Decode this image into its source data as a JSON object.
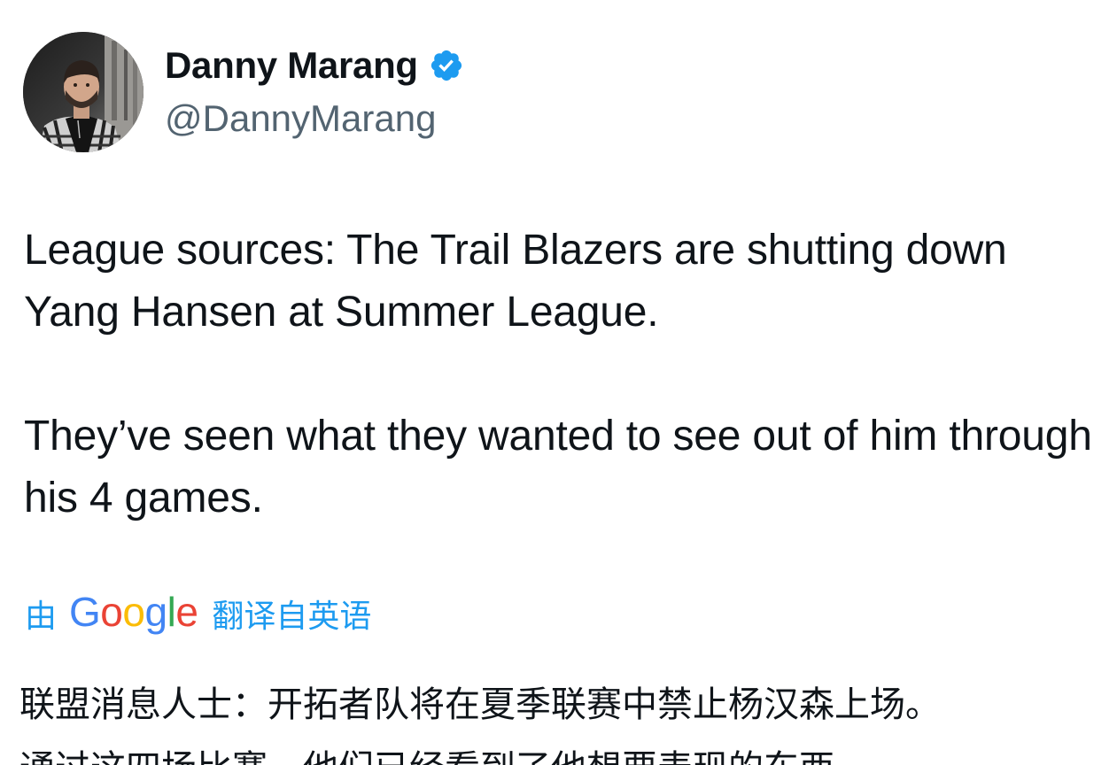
{
  "author": {
    "display_name": "Danny Marang",
    "handle": "@DannyMarang",
    "verified": true,
    "verified_color": "#1d9bf0"
  },
  "tweet": {
    "paragraphs": [
      "League sources: The Trail Blazers are shutting down Yang Hansen at Summer League.",
      "They’ve seen what they wanted to see out of him through his 4 games."
    ]
  },
  "translation": {
    "prefix": "由",
    "provider_letters": [
      "G",
      "o",
      "o",
      "g",
      "l",
      "e"
    ],
    "suffix": "翻译自英语",
    "link_color": "#1d9bf0",
    "lines": [
      "联盟消息人士：开拓者队将在夏季联赛中禁止杨汉森上场。",
      "通过这四场比赛，他们已经看到了他想要表现的东西。"
    ]
  }
}
